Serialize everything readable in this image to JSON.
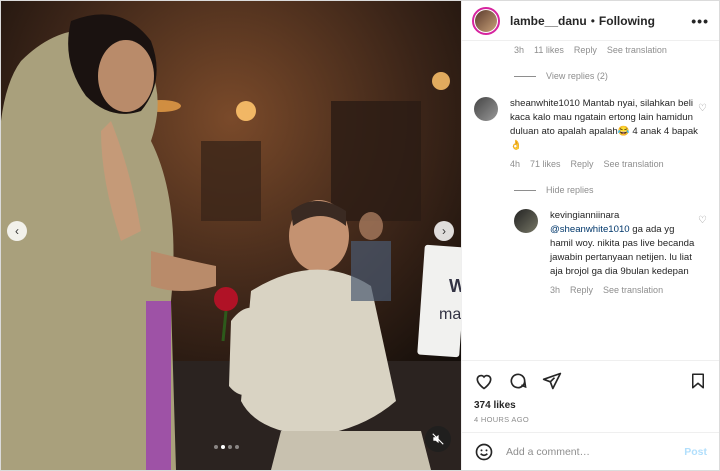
{
  "post": {
    "username": "lambe__danu",
    "separator": "•",
    "follow_status": "Following",
    "more_label": "•••"
  },
  "media": {
    "sign_text_1": "W",
    "sign_text_2": "ma"
  },
  "comments": {
    "top_meta": {
      "time": "3h",
      "likes": "11 likes",
      "reply": "Reply",
      "translate": "See translation"
    },
    "view_replies": "View replies (2)",
    "comment2": {
      "username": "sheanwhite1010",
      "text": "Mantab nyai, silahkan beli kaca kalo mau ngatain ertong lain hamidun duluan ato apalah apalah😂 4 anak 4 bapak👌",
      "time": "4h",
      "likes": "71 likes",
      "reply": "Reply",
      "translate": "See translation"
    },
    "hide_replies": "Hide replies",
    "reply1": {
      "username": "kevingianniinara",
      "mention": "@sheanwhite1010",
      "text": " ga ada yg hamil woy. nikita pas live becanda jawabin pertanyaan netijen. lu liat aja brojol ga dia 9bulan kedepan",
      "time": "3h",
      "reply": "Reply",
      "translate": "See translation"
    }
  },
  "stats": {
    "likes": "374 likes",
    "time": "4 HOURS AGO"
  },
  "composer": {
    "placeholder": "Add a comment…",
    "post_label": "Post"
  },
  "colors": {
    "link": "#00376b",
    "muted": "#8e8e8e",
    "post_disabled": "#b2dffc"
  }
}
